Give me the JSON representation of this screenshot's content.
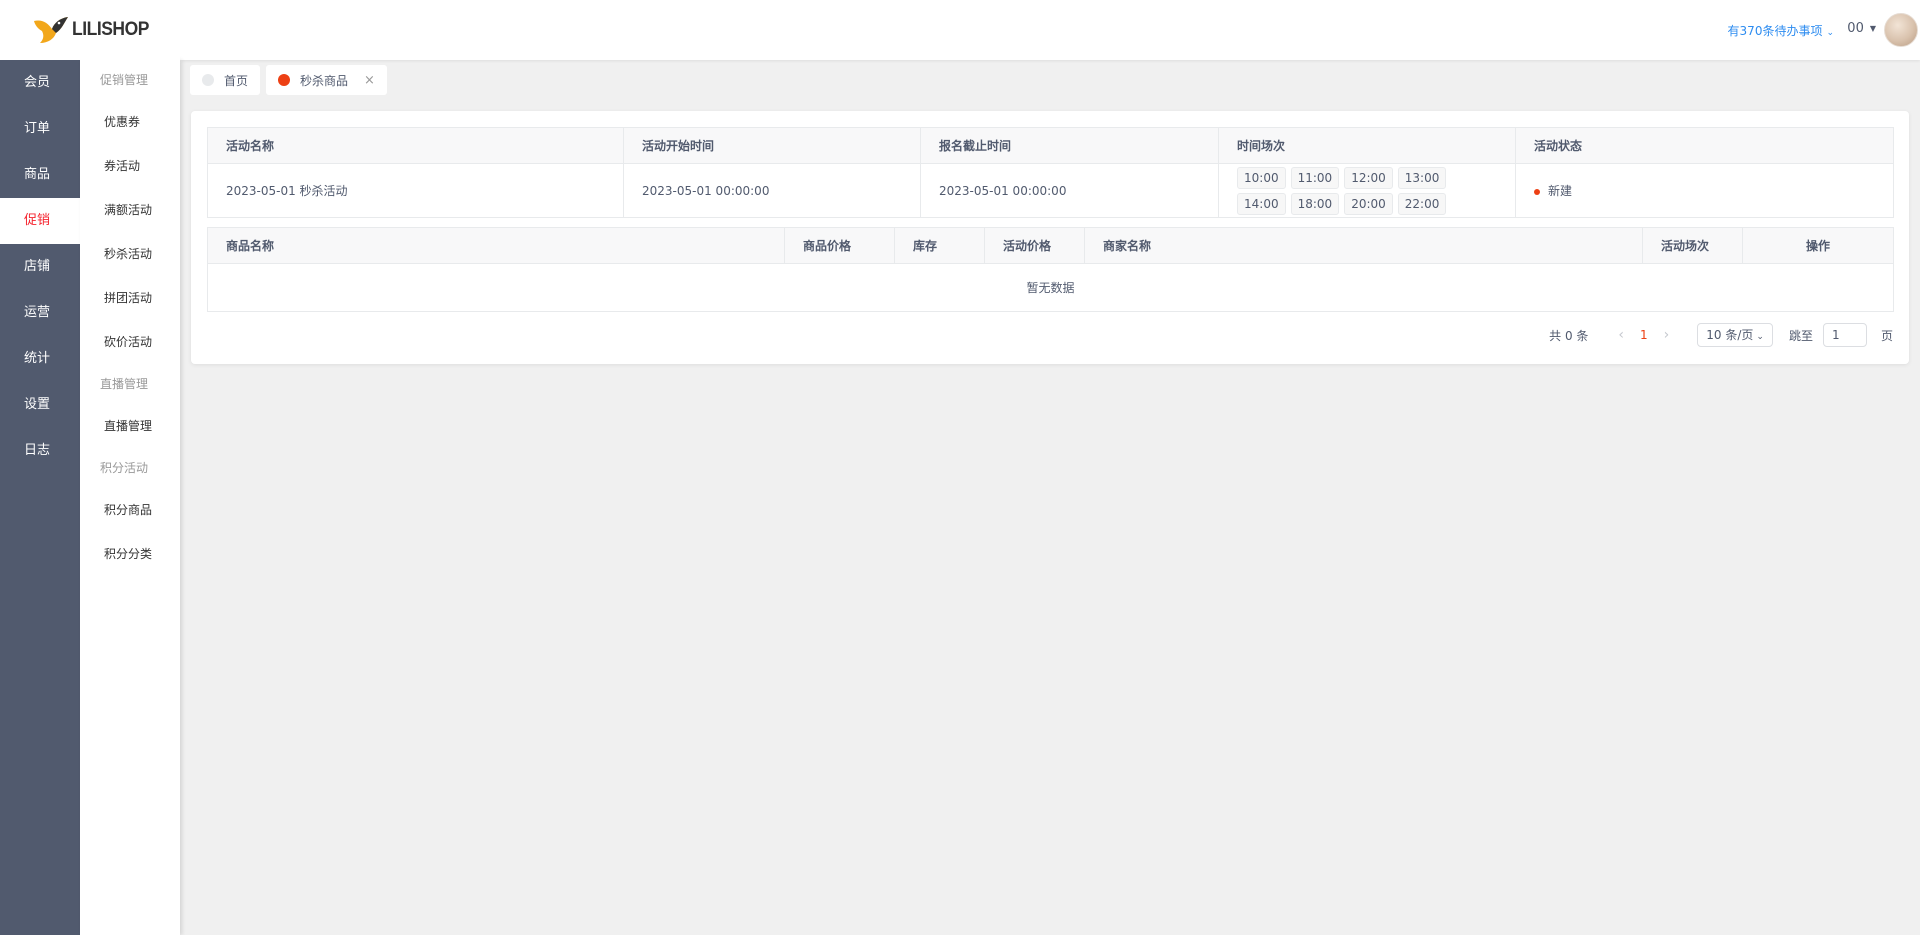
{
  "logo": {
    "text": "LILISHOP"
  },
  "main_nav": [
    {
      "label": "会员"
    },
    {
      "label": "订单"
    },
    {
      "label": "商品"
    },
    {
      "label": "促销",
      "active": true
    },
    {
      "label": "店铺"
    },
    {
      "label": "运营"
    },
    {
      "label": "统计"
    },
    {
      "label": "设置"
    },
    {
      "label": "日志"
    }
  ],
  "sub_nav": {
    "group1": "促销管理",
    "group1_items": [
      "优惠券",
      "券活动",
      "满额活动",
      "秒杀活动",
      "拼团活动",
      "砍价活动"
    ],
    "group2": "直播管理",
    "group2_items": [
      "直播管理"
    ],
    "group3": "积分活动",
    "group3_items": [
      "积分商品",
      "积分分类"
    ]
  },
  "header": {
    "todo": "有370条待办事项",
    "user": "00"
  },
  "tabs": [
    {
      "label": "首页"
    },
    {
      "label": "秒杀商品",
      "active": true,
      "close": "×"
    }
  ],
  "activity_table": {
    "headers": [
      "活动名称",
      "活动开始时间",
      "报名截止时间",
      "时间场次",
      "活动状态"
    ],
    "row": {
      "name": "2023-05-01 秒杀活动",
      "start": "2023-05-01 00:00:00",
      "deadline": "2023-05-01 00:00:00",
      "slots": [
        "10:00",
        "11:00",
        "12:00",
        "13:00",
        "14:00",
        "18:00",
        "20:00",
        "22:00"
      ],
      "status": "新建"
    }
  },
  "goods_table": {
    "headers": [
      "商品名称",
      "商品价格",
      "库存",
      "活动价格",
      "商家名称",
      "活动场次",
      "操作"
    ],
    "empty": "暂无数据"
  },
  "pagination": {
    "total": "共 0 条",
    "current_page": "1",
    "page_size": "10 条/页",
    "jump_label": "跳至",
    "jump_value": "1",
    "page_suffix": "页"
  },
  "colors": {
    "accent": "#ed4014",
    "sidebar": "#515a6e",
    "link": "#2d8cf0"
  }
}
